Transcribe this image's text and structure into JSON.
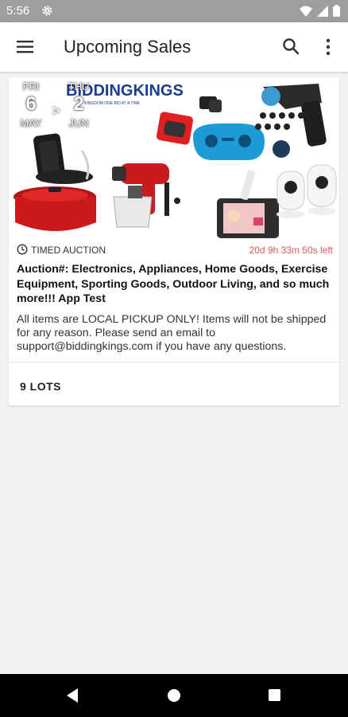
{
  "status_bar": {
    "time": "5:56"
  },
  "app_bar": {
    "title": "Upcoming Sales"
  },
  "sale": {
    "brand_logo": "BIDDINGKINGS",
    "brand_tagline": "KINGDOM ONE BID AT A TIME",
    "start": {
      "dow": "FRI",
      "day": "6",
      "month": "MAY"
    },
    "separator": ">",
    "end": {
      "dow": "THU",
      "day": "2",
      "month": "JUN"
    },
    "auction_type": "TIMED AUCTION",
    "time_left": "20d 9h 33m 50s left",
    "title": "Auction#: Electronics, Appliances, Home Goods, Exercise Equipment, Sporting Goods, Outdoor Living, and so much more!!! App Test",
    "description": "All items are LOCAL PICKUP ONLY! Items will not be shipped for any reason. Please send an email to support@biddingkings.com if you have any questions.",
    "lots": "9 LOTS"
  },
  "icons": {
    "status": [
      "gear-icon",
      "wifi-icon",
      "signal-icon",
      "battery-icon"
    ],
    "app_bar": [
      "menu-icon",
      "search-icon",
      "more-vert-icon"
    ],
    "nav": [
      "back-icon",
      "home-icon",
      "recents-icon"
    ]
  }
}
